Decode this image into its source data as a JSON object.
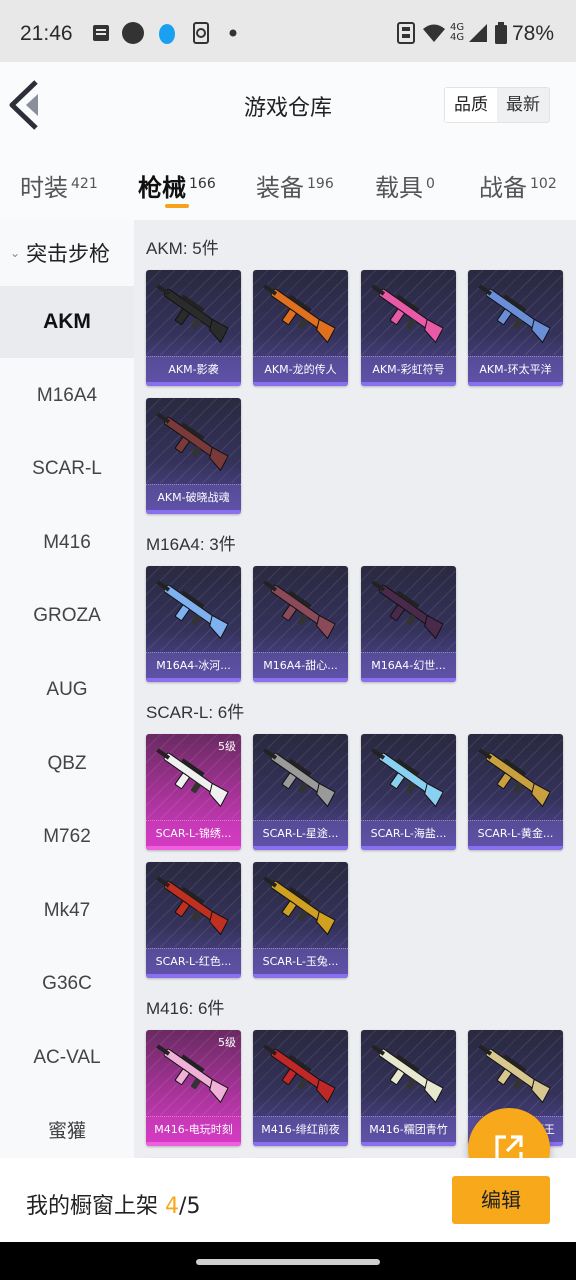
{
  "status_bar": {
    "time": "21:46",
    "battery": "78%",
    "icons": [
      "notes-icon",
      "circle-icon",
      "penguin-icon",
      "phone-sync-icon",
      "dot-icon",
      "nfc-icon",
      "wifi-icon",
      "signal-4g-icon",
      "battery-icon"
    ],
    "net_label_a": "4G",
    "net_label_b": "4G"
  },
  "header": {
    "title": "游戏仓库",
    "sort_options": [
      "品质",
      "最新"
    ],
    "sort_selected": "品质"
  },
  "tabs": [
    {
      "label": "时装",
      "count": "421"
    },
    {
      "label": "枪械",
      "count": "166",
      "active": true
    },
    {
      "label": "装备",
      "count": "196"
    },
    {
      "label": "载具",
      "count": "0"
    },
    {
      "label": "战备",
      "count": "102"
    }
  ],
  "sidebar": {
    "category": "突击步枪",
    "items": [
      "AKM",
      "M16A4",
      "SCAR-L",
      "M416",
      "GROZA",
      "AUG",
      "QBZ",
      "M762",
      "Mk47",
      "G36C",
      "AC-VAL",
      "蜜獾"
    ],
    "active": "AKM"
  },
  "sections": [
    {
      "title": "AKM: 5件",
      "items": [
        {
          "name": "AKM-影袭",
          "color": "#2b2b2b"
        },
        {
          "name": "AKM-龙的传人",
          "color": "#e0701e"
        },
        {
          "name": "AKM-彩虹符号",
          "color": "#e85aa8"
        },
        {
          "name": "AKM-环太平洋",
          "color": "#6a8fd8"
        },
        {
          "name": "AKM-破晓战魂",
          "color": "#7a3a3a"
        }
      ]
    },
    {
      "title": "M16A4: 3件",
      "items": [
        {
          "name": "M16A4-冰河...",
          "color": "#7fb0f0"
        },
        {
          "name": "M16A4-甜心...",
          "color": "#8a4a5a"
        },
        {
          "name": "M16A4-幻世...",
          "color": "#4a2a4a"
        }
      ]
    },
    {
      "title": "SCAR-L: 6件",
      "items": [
        {
          "name": "SCAR-L-锦绣...",
          "color": "#f0f0f0",
          "level": "5级",
          "pink": true
        },
        {
          "name": "SCAR-L-星途...",
          "color": "#9a9a9a"
        },
        {
          "name": "SCAR-L-海盐...",
          "color": "#8ad0f0"
        },
        {
          "name": "SCAR-L-黄金...",
          "color": "#c8a040"
        },
        {
          "name": "SCAR-L-红色...",
          "color": "#c03020"
        },
        {
          "name": "SCAR-L-玉兔...",
          "color": "#d0a020"
        }
      ]
    },
    {
      "title": "M416: 6件",
      "items": [
        {
          "name": "M416-电玩时刻",
          "color": "#f0b0d8",
          "level": "5级",
          "pink": true
        },
        {
          "name": "M416-绯红前夜",
          "color": "#c02828"
        },
        {
          "name": "M416-糯团青竹",
          "color": "#e8e8d0"
        },
        {
          "name": "M416-雪域狮王",
          "color": "#d8c890"
        },
        {
          "name": "",
          "color": "#555555"
        },
        {
          "name": "",
          "color": "#555555"
        }
      ]
    }
  ],
  "bottom_bar": {
    "label": "我的橱窗上架",
    "current": "4",
    "separator": "/",
    "total": "5",
    "edit_label": "编辑"
  },
  "colors": {
    "accent": "#f7a81b",
    "rare": "#8a6ff0",
    "legendary": "#f05ee0"
  }
}
